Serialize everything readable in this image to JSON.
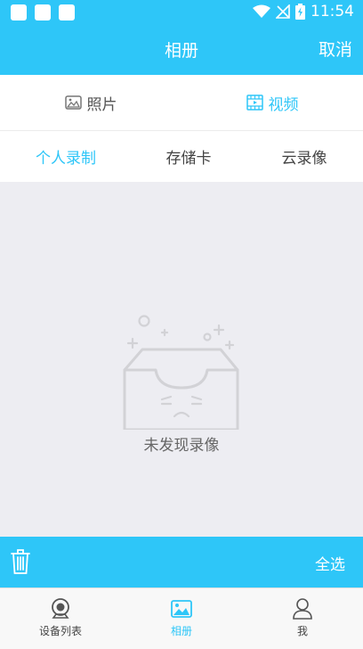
{
  "status_bar": {
    "time": "11:54"
  },
  "header": {
    "title": "相册",
    "cancel_label": "取消"
  },
  "type_tabs": [
    {
      "label": "照片",
      "icon": "image-icon",
      "active": false
    },
    {
      "label": "视频",
      "icon": "film-icon",
      "active": true
    }
  ],
  "source_tabs": [
    {
      "label": "个人录制",
      "active": true
    },
    {
      "label": "存储卡",
      "active": false
    },
    {
      "label": "云录像",
      "active": false
    }
  ],
  "empty_state": {
    "message": "未发现录像",
    "icon": "empty-box-icon"
  },
  "action_bar": {
    "select_all_label": "全选",
    "delete_icon": "trash-icon"
  },
  "bottom_nav": [
    {
      "label": "设备列表",
      "icon": "camera-icon",
      "active": false
    },
    {
      "label": "相册",
      "icon": "album-icon",
      "active": true
    },
    {
      "label": "我",
      "icon": "person-icon",
      "active": false
    }
  ],
  "colors": {
    "accent": "#2ec6f8",
    "text": "#444444",
    "background": "#ededf2"
  }
}
